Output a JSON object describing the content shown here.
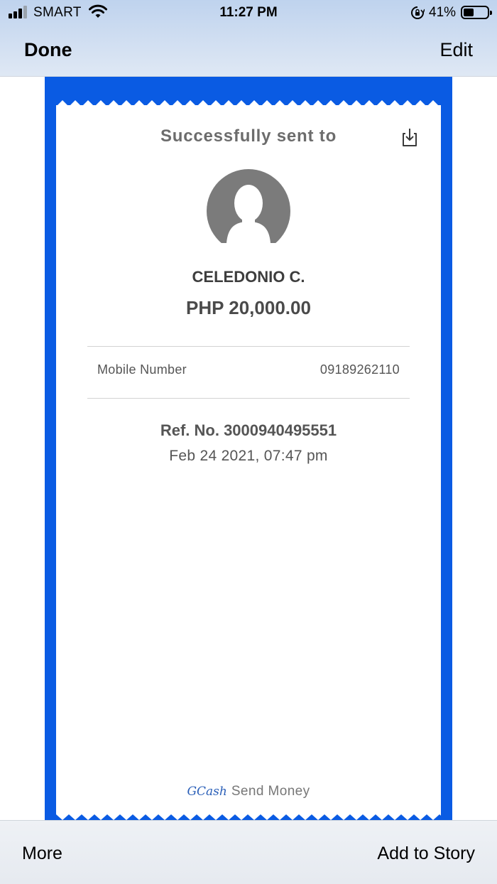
{
  "status_bar": {
    "carrier": "SMART",
    "time": "11:27 PM",
    "battery_percent": "41%",
    "battery_level": 0.41,
    "signal_bars": 3,
    "icons": [
      "signal-icon",
      "wifi-icon",
      "orientation-lock-icon",
      "battery-icon"
    ]
  },
  "nav": {
    "done_label": "Done",
    "edit_label": "Edit"
  },
  "receipt": {
    "title": "Successfully sent to",
    "download_icon": "download-icon",
    "avatar_icon": "default-avatar-icon",
    "recipient_name": "CELEDONIO C.",
    "amount": "PHP 20,000.00",
    "details": [
      {
        "label": "Mobile Number",
        "value": "09189262110"
      }
    ],
    "reference": "Ref. No. 3000940495551",
    "datetime": "Feb 24 2021, 07:47 pm",
    "footer": {
      "brand": "GCash",
      "service": "Send Money"
    },
    "colors": {
      "frame": "#0a5be3",
      "paper": "#ffffff",
      "text": "#555555"
    }
  },
  "toolbar": {
    "more_label": "More",
    "story_label": "Add to Story"
  }
}
